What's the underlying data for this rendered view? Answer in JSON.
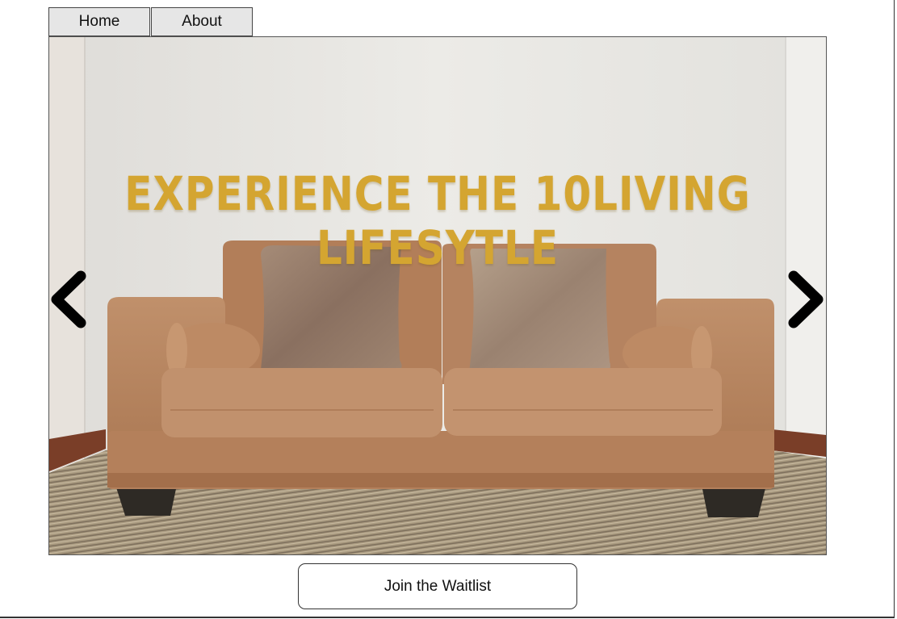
{
  "nav": {
    "tabs": [
      {
        "label": "Home"
      },
      {
        "label": "About"
      }
    ]
  },
  "hero": {
    "headline": "EXPERIENCE THE 10LIVING LIFESYTLE",
    "image": {
      "subject": "tan fabric loveseat with two velvet cushions and bolster pillows against a white wall"
    },
    "prev_icon": "chevron-left-icon",
    "next_icon": "chevron-right-icon"
  },
  "cta": {
    "label": "Join the Waitlist"
  },
  "colors": {
    "headline": "#d4a531",
    "sofa": "#b98561",
    "wall": "#ebeae6",
    "tab_background": "#e6e6e6"
  }
}
